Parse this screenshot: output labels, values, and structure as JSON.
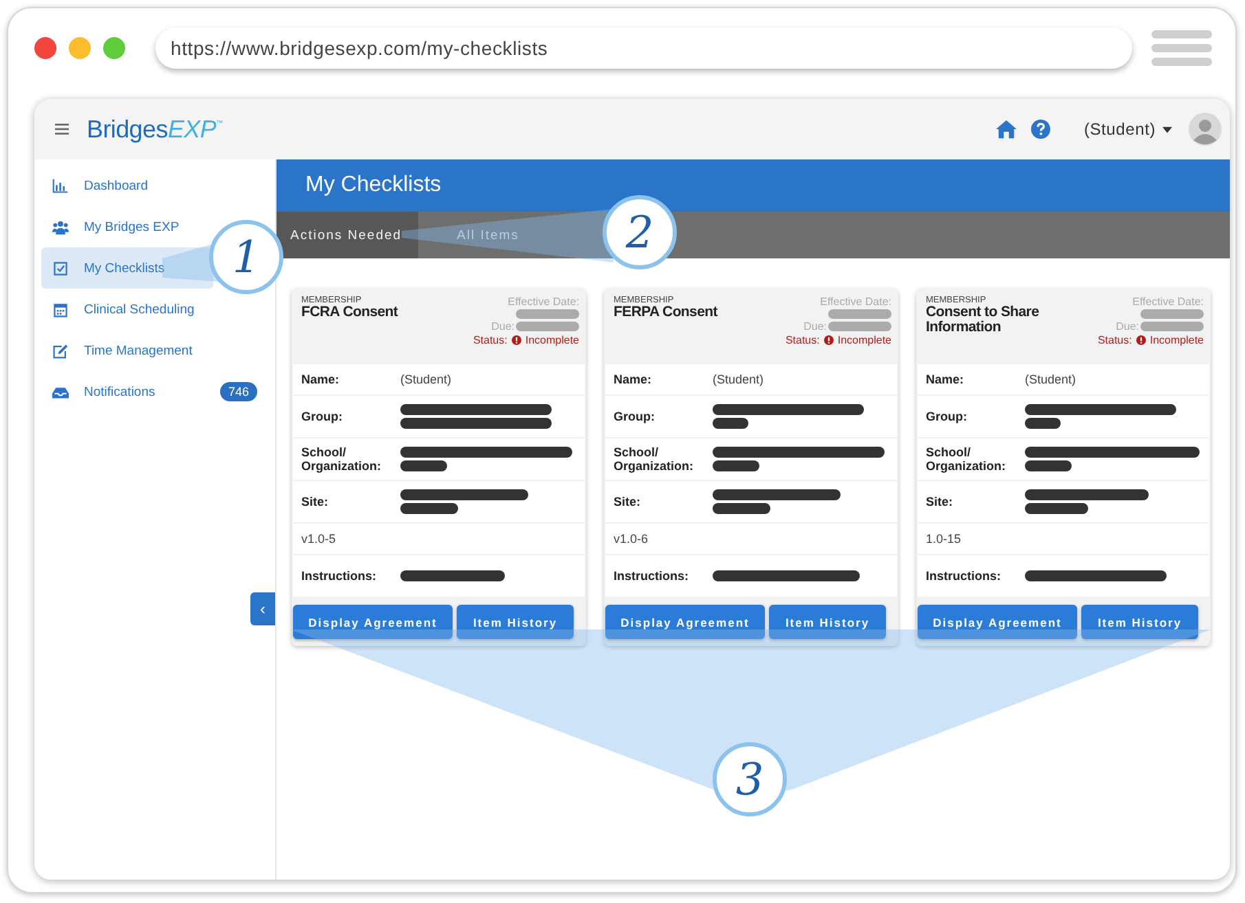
{
  "browser": {
    "url": "https://www.bridgesexp.com/my-checklists"
  },
  "header": {
    "logo": "Bridges",
    "logo_accent": "EXP",
    "logo_mark": "™",
    "user": "(Student)"
  },
  "sidebar": {
    "items": [
      {
        "label": "Dashboard",
        "selected": false
      },
      {
        "label": "My Bridges EXP",
        "selected": false
      },
      {
        "label": "My Checklists",
        "selected": true
      },
      {
        "label": "Clinical Scheduling",
        "selected": false
      },
      {
        "label": "Time Management",
        "selected": false
      },
      {
        "label": "Notifications",
        "selected": false,
        "badge": "746"
      }
    ],
    "collapse": "‹"
  },
  "page_title": "My Checklists",
  "tabs": [
    {
      "label": "Actions Needed",
      "selected": true
    },
    {
      "label": "All Items",
      "selected": false
    }
  ],
  "cards": [
    {
      "category": "MEMBERSHIP",
      "title": "FCRA Consent",
      "effective_label": "Effective Date:",
      "due_label": "Due:",
      "status_label": "Status:",
      "status": "Incomplete",
      "rows": [
        {
          "kind": "text",
          "label": "Name:",
          "value": "(Student)"
        },
        {
          "kind": "redacted",
          "label": "Group:"
        },
        {
          "kind": "redacted",
          "label": "School/ Organization:"
        },
        {
          "kind": "redacted",
          "label": "Site:"
        },
        {
          "kind": "plain",
          "value": "v1.0-5"
        },
        {
          "kind": "redacted",
          "label": "Instructions:"
        }
      ],
      "buttons": [
        "Display Agreement",
        "Item History"
      ]
    },
    {
      "category": "MEMBERSHIP",
      "title": "FERPA Consent",
      "effective_label": "Effective Date:",
      "due_label": "Due:",
      "status_label": "Status:",
      "status": "Incomplete",
      "rows": [
        {
          "kind": "text",
          "label": "Name:",
          "value": "(Student)"
        },
        {
          "kind": "redacted",
          "label": "Group:"
        },
        {
          "kind": "redacted",
          "label": "School/ Organization:"
        },
        {
          "kind": "redacted",
          "label": "Site:"
        },
        {
          "kind": "plain",
          "value": "v1.0-6"
        },
        {
          "kind": "redacted",
          "label": "Instructions:"
        }
      ],
      "buttons": [
        "Display Agreement",
        "Item History"
      ]
    },
    {
      "category": "MEMBERSHIP",
      "title": "Consent to Share Information",
      "effective_label": "Effective Date:",
      "due_label": "Due:",
      "status_label": "Status:",
      "status": "Incomplete",
      "rows": [
        {
          "kind": "text",
          "label": "Name:",
          "value": "(Student)"
        },
        {
          "kind": "redacted",
          "label": "Group:"
        },
        {
          "kind": "redacted",
          "label": "School/ Organization:"
        },
        {
          "kind": "redacted",
          "label": "Site:"
        },
        {
          "kind": "plain",
          "value": "1.0-15"
        },
        {
          "kind": "redacted",
          "label": "Instructions:"
        }
      ],
      "buttons": [
        "Display Agreement",
        "Item History"
      ]
    }
  ],
  "callouts": [
    {
      "number": "1"
    },
    {
      "number": "2"
    },
    {
      "number": "3"
    }
  ]
}
